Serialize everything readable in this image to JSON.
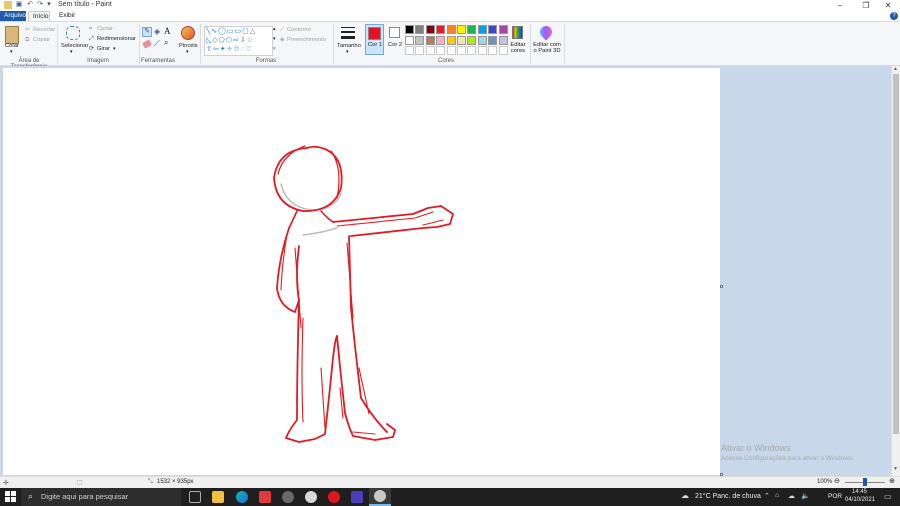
{
  "window": {
    "title": "Sem título - Paint",
    "minimize": "–",
    "maximize": "❐",
    "close": "✕",
    "help": "?"
  },
  "tabs": [
    {
      "label": "Arquivo"
    },
    {
      "label": "Início"
    },
    {
      "label": "Exibir"
    }
  ],
  "ribbon": {
    "clipboard": {
      "paste": "Colar",
      "cut": "Recortar",
      "copy": "Copiar",
      "group": "Área de Transferência"
    },
    "image": {
      "select": "Selecionar",
      "crop": "Cortar",
      "resize": "Redimensionar",
      "rotate": "Girar",
      "group": "Imagem"
    },
    "tools": {
      "group": "Ferramentas"
    },
    "brushes": {
      "label": "Pincéis"
    },
    "shapes": {
      "outline": "Contorno",
      "fill": "Preenchimento",
      "group": "Formas"
    },
    "size": {
      "label": "Tamanho"
    },
    "color1": {
      "label": "Cor 1",
      "value": "#e81123"
    },
    "color2": {
      "label": "Cor 2",
      "value": "#ffffff"
    },
    "colors": {
      "group": "Cores"
    },
    "edit_colors": {
      "label": "Editar cores"
    },
    "paint3d": {
      "label": "Editar com o Paint 3D"
    }
  },
  "palette": [
    "#000000",
    "#7f7f7f",
    "#880015",
    "#ed1c24",
    "#ff7f27",
    "#fff200",
    "#22b14c",
    "#00a2e8",
    "#3f48cc",
    "#a349a4",
    "#ffffff",
    "#c3c3c3",
    "#b97a57",
    "#ffaec9",
    "#ffc90e",
    "#efe4b0",
    "#b5e61d",
    "#99d9ea",
    "#7092be",
    "#c8bfe7"
  ],
  "status": {
    "dimensions": "1532 × 935px",
    "zoom": "100%"
  },
  "activation": {
    "title": "Ativar o Windows",
    "subtitle": "Acesse Configurações para ativar o Windows."
  },
  "taskbar": {
    "search_placeholder": "Digite aqui para pesquisar",
    "weather": "21°C  Panc. de chuva",
    "language": "POR",
    "time": "14:45",
    "date": "04/10/2021"
  }
}
